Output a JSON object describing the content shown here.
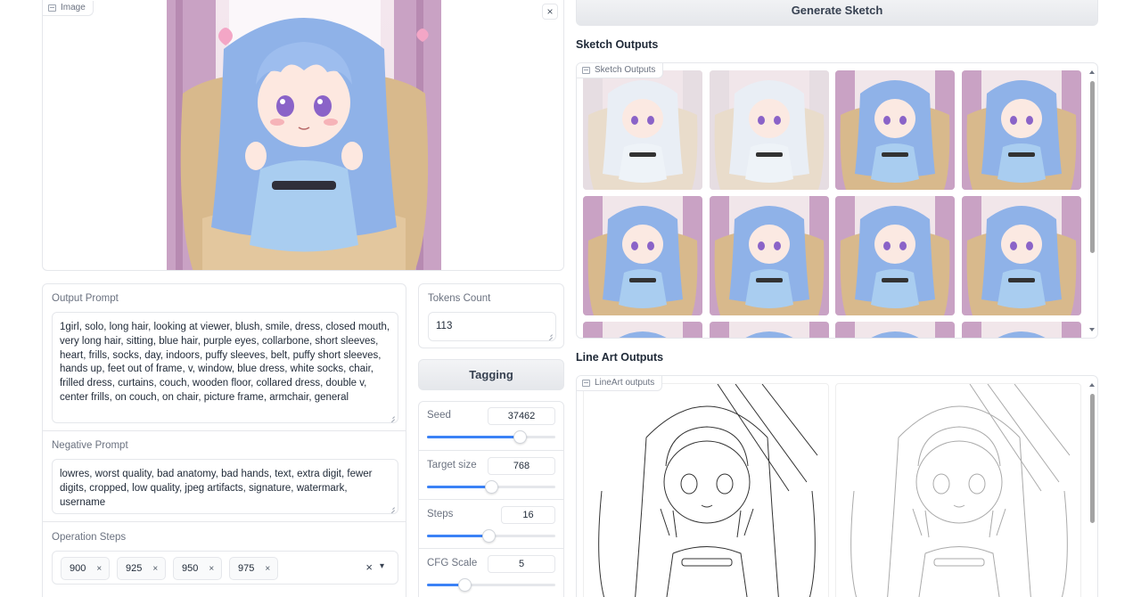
{
  "image_panel": {
    "label": "Image",
    "close_symbol": "×"
  },
  "output_prompt": {
    "label": "Output Prompt",
    "value": "1girl, solo, long hair, looking at viewer, blush, smile, dress, closed mouth, very long hair, sitting, blue hair, purple eyes, collarbone, short sleeves, heart, frills, socks, day, indoors, puffy sleeves, belt, puffy short sleeves, hands up, feet out of frame, v, window, blue dress, white socks, chair, frilled dress, curtains, couch, wooden floor, collared dress, double v, center frills, on couch, on chair, picture frame, armchair, general"
  },
  "tokens": {
    "label": "Tokens Count",
    "value": "113"
  },
  "tagging_button": "Tagging",
  "negative_prompt": {
    "label": "Negative Prompt",
    "value": "lowres, worst quality, bad anatomy, bad hands, text, extra digit, fewer digits, cropped, low quality, jpeg artifacts, signature, watermark, username"
  },
  "operation_steps": {
    "label": "Operation Steps",
    "chips": [
      "900",
      "925",
      "950",
      "975"
    ],
    "chip_remove": "×",
    "clear_symbol": "×",
    "dropdown_symbol": "▾"
  },
  "sliders": [
    {
      "label": "Seed",
      "value": "37462",
      "fraction": 0.72
    },
    {
      "label": "Target size",
      "value": "768",
      "fraction": 0.5
    },
    {
      "label": "Steps",
      "value": "16",
      "fraction": 0.48
    },
    {
      "label": "CFG Scale",
      "value": "5",
      "fraction": 0.29
    }
  ],
  "generate_button": "Generate Sketch",
  "sketch_section": {
    "title": "Sketch Outputs",
    "gallery_label": "Sketch Outputs",
    "thumb_count": 12
  },
  "lineart_section": {
    "title": "Line Art Outputs",
    "gallery_label": "LineArt outputs",
    "thumb_count": 2
  },
  "colors": {
    "accent": "#3b82f6",
    "hair": "#8fb2e8",
    "dress": "#a9cdf0",
    "couch": "#d8b98c",
    "curtain": "#c9a2c4",
    "border": "#e5e7eb"
  }
}
